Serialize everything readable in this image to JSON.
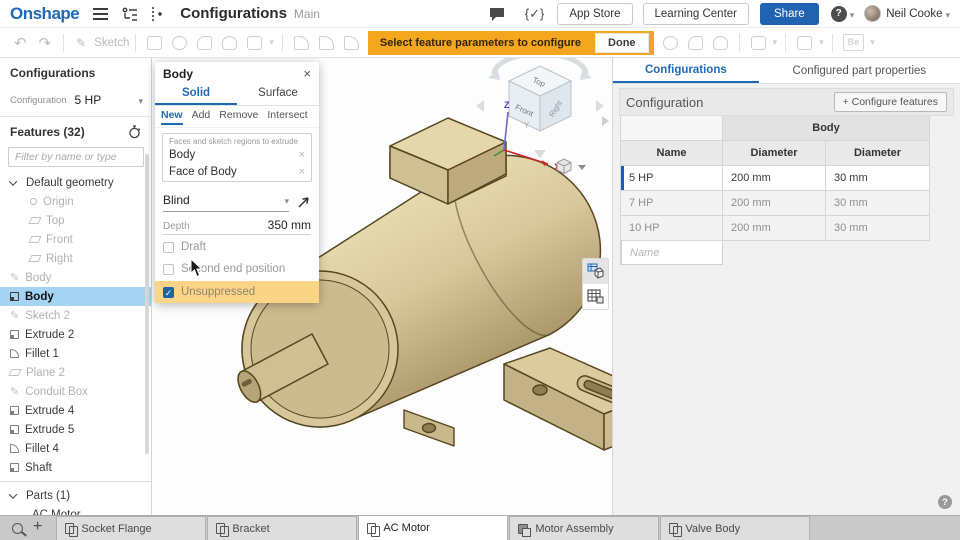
{
  "header": {
    "logo": "Onshape",
    "title": "Configurations",
    "subtitle": "Main",
    "code_icon": "{✓}",
    "app_store": "App Store",
    "learning_center": "Learning Center",
    "share": "Share",
    "help": "?",
    "user": "Neil Cooke"
  },
  "toolbar": {
    "sketch": "Sketch",
    "banner_text": "Select feature parameters to configure",
    "done": "Done",
    "fs_badge": "Be"
  },
  "left_panel": {
    "title": "Configurations",
    "config_label": "Configuration",
    "config_value": "5 HP",
    "features_label": "Features (32)",
    "filter_placeholder": "Filter by name or type",
    "tree": [
      {
        "label": "Default geometry"
      },
      {
        "label": "Origin"
      },
      {
        "label": "Top"
      },
      {
        "label": "Front"
      },
      {
        "label": "Right"
      },
      {
        "label": "Body"
      },
      {
        "label": "Body"
      },
      {
        "label": "Sketch 2"
      },
      {
        "label": "Extrude 2"
      },
      {
        "label": "Fillet 1"
      },
      {
        "label": "Plane 2"
      },
      {
        "label": "Conduit Box"
      },
      {
        "label": "Extrude 4"
      },
      {
        "label": "Extrude 5"
      },
      {
        "label": "Fillet 4"
      },
      {
        "label": "Shaft"
      }
    ],
    "parts_label": "Parts (1)",
    "part_item": "AC Motor"
  },
  "dialog": {
    "title": "Body",
    "tab_solid": "Solid",
    "tab_surface": "Surface",
    "op_new": "New",
    "op_add": "Add",
    "op_remove": "Remove",
    "op_intersect": "Intersect",
    "selection_label": "Faces and sketch regions to extrude",
    "selection_1": "Body",
    "selection_2": "Face of Body",
    "end_type": "Blind",
    "depth_label": "Depth",
    "depth_value": "350 mm",
    "cb_draft": "Draft",
    "cb_second": "Second end position",
    "cb_unsuppressed": "Unsuppressed"
  },
  "viewport": {
    "cube_top": "Top",
    "cube_front": "Front",
    "cube_right": "Right",
    "axis_x": "X",
    "axis_y": "Y",
    "axis_z": "Z"
  },
  "right_panel": {
    "tab_configurations": "Configurations",
    "tab_properties": "Configured part properties",
    "section_title": "Configuration",
    "configure_button": "+ Configure features",
    "table": {
      "group": "Body",
      "col_name": "Name",
      "col_d1": "Diameter",
      "col_d2": "Diameter",
      "rows": [
        {
          "name": "5 HP",
          "d1": "200 mm",
          "d2": "30 mm"
        },
        {
          "name": "7 HP",
          "d1": "200 mm",
          "d2": "30 mm"
        },
        {
          "name": "10 HP",
          "d1": "200 mm",
          "d2": "30 mm"
        }
      ],
      "new_row_placeholder": "Name"
    }
  },
  "bottom_bar": {
    "tabs": [
      {
        "label": "Socket Flange"
      },
      {
        "label": "Bracket"
      },
      {
        "label": "AC Motor"
      },
      {
        "label": "Motor Assembly"
      },
      {
        "label": "Valve Body"
      }
    ]
  },
  "colors": {
    "accent": "#1f6ab5",
    "banner": "#f3a61e",
    "highlight": "#fad588",
    "tree_selection": "#a7d3f2",
    "motor_tan": "#d8c89c"
  }
}
